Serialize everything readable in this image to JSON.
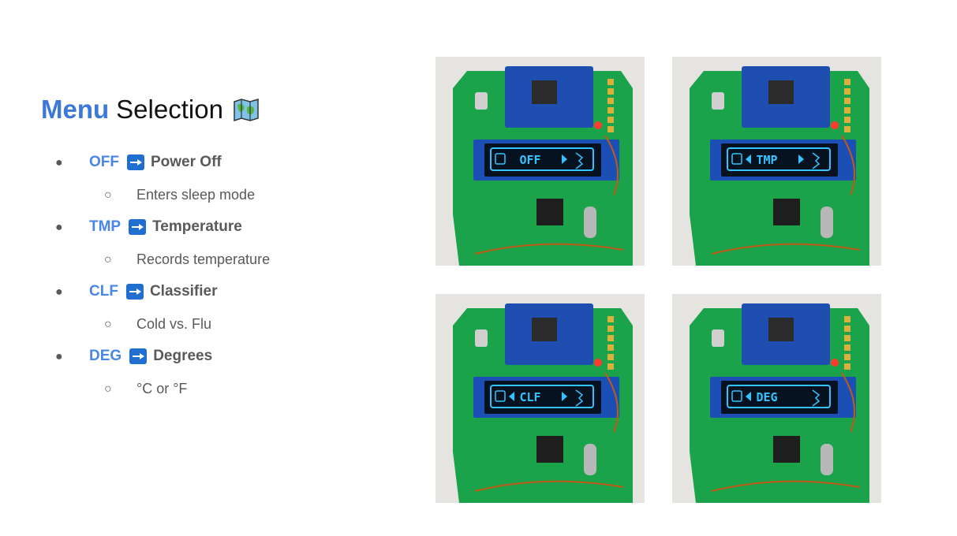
{
  "title": {
    "accent": "Menu",
    "rest": "Selection",
    "icon": "map-icon"
  },
  "menu_items": [
    {
      "code": "OFF",
      "name": "Power Off",
      "detail": "Enters sleep mode"
    },
    {
      "code": "TMP",
      "name": "Temperature",
      "detail": "Records temperature"
    },
    {
      "code": "CLF",
      "name": "Classifier",
      "detail": "Cold vs. Flu"
    },
    {
      "code": "DEG",
      "name": "Degrees",
      "detail": "°C or °F"
    }
  ],
  "photos": [
    {
      "screen_text": "OFF",
      "has_left_arrow": false,
      "has_right_arrow": true
    },
    {
      "screen_text": "TMP",
      "has_left_arrow": true,
      "has_right_arrow": true
    },
    {
      "screen_text": "CLF",
      "has_left_arrow": true,
      "has_right_arrow": true
    },
    {
      "screen_text": "DEG",
      "has_left_arrow": true,
      "has_right_arrow": false
    }
  ],
  "colors": {
    "accent": "#3c78d8",
    "code": "#4a86e8",
    "arrow_icon": "#1f6fd1",
    "pcb": "#1aa34a",
    "oled_text": "#33c4ff"
  }
}
